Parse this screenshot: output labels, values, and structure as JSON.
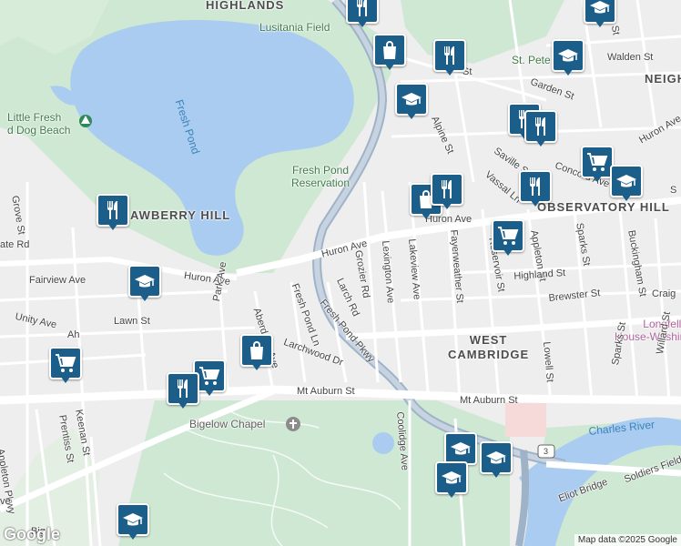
{
  "map": {
    "neighborhoods": {
      "highlands": "HIGHLANDS",
      "strawberry_hill": "STRAWBERRY HILL",
      "observatory_hill": "OBSERVATORY HILL",
      "west_cambridge": "WEST\nCAMBRIDGE",
      "neigh": "NEIGH"
    },
    "parks": {
      "lusitania_field": "Lusitania Field",
      "fresh_pond_reservation": "Fresh Pond\nReservation",
      "little_fresh_dog_beach": "Little Fresh\nd Dog Beach",
      "st_peters_field": "St. Pete        ld"
    },
    "water": {
      "fresh_pond": "Fresh Pond",
      "charles_river": "Charles River"
    },
    "places": {
      "bigelow_chapel": "Bigelow Chapel",
      "longfellow": "Longfellow\nHouse-Washington's..."
    },
    "streets": {
      "huron_ave_left": "Huron Ave",
      "huron_ave_mid": "Huron Ave",
      "huron_ave_right": "Huron Ave",
      "huron_ave_far": "Huron Ave",
      "mt_auburn_left": "Mt Auburn St",
      "mt_auburn_right": "Mt Auburn St",
      "fresh_pond_pkwy": "Fresh Pond Pkwy",
      "grozier_rd": "Grozier Rd",
      "larch_rd": "Larch Rd",
      "fresh_pond_ln": "Fresh Pond Ln",
      "larchwood_dr": "Larchwood Dr",
      "aberdeen_ave": "Aberdeen Ave",
      "lexington_ave": "Lexington Ave",
      "lakeview_ave": "Lakeview Ave",
      "fayerweather_st": "Fayerweather St",
      "reservoir_st": "Reservoir St",
      "appleton_st": "Appleton St",
      "sparks_st_top": "Sparks St",
      "sparks_st_bottom": "Sparks St",
      "buckingham_st": "Buckingham St",
      "highland_st": "Highland St",
      "brewster_st": "Brewster St",
      "lowell_st": "Lowell St",
      "willard_st": "Willard St",
      "craig": "Craig",
      "concord_ave": "Concord Ave",
      "garden_st": "Garden St",
      "walden_st": "Walden St",
      "alpine_st": "Alpine St",
      "saville_st": "Saville St",
      "vassal_ln": "Vassal Ln",
      "coolidge_ave": "Coolidge Ave",
      "grove_st": "Grove St",
      "fairview_ave": "Fairview Ave",
      "unity_ave": "Unity Ave",
      "lawn_st": "Lawn St",
      "park_ave": "Park Ave",
      "keenan_st": "Keenan St",
      "prentiss_st": "Prentiss St",
      "appleton_pkwy": "Appleton Pkwy",
      "eliot_bridge": "Eliot Bridge",
      "soldiers_field_rd": "Soldiers Field Rd",
      "route_badge": "3",
      "partial_ate_rd": "ate Rd",
      "partial_enan_st": "enan St",
      "partial_st": "St",
      "partial_s": "S",
      "partial_ve": "ve",
      "partial_ah": "Ah",
      "partial_big": "Big"
    },
    "pins": [
      {
        "type": "utensils-icon"
      },
      {
        "type": "shopping-bag-icon"
      },
      {
        "type": "utensils-icon"
      },
      {
        "type": "graduation-cap-icon"
      },
      {
        "type": "graduation-cap-icon"
      },
      {
        "type": "graduation-cap-icon"
      },
      {
        "type": "utensils-icon"
      },
      {
        "type": "utensils-icon"
      },
      {
        "type": "shopping-cart-icon"
      },
      {
        "type": "graduation-cap-icon"
      },
      {
        "type": "shopping-bag-icon"
      },
      {
        "type": "utensils-icon"
      },
      {
        "type": "utensils-icon"
      },
      {
        "type": "shopping-cart-icon"
      },
      {
        "type": "utensils-icon"
      },
      {
        "type": "graduation-cap-icon"
      },
      {
        "type": "shopping-cart-icon"
      },
      {
        "type": "shopping-bag-icon"
      },
      {
        "type": "shopping-cart-icon"
      },
      {
        "type": "utensils-icon"
      },
      {
        "type": "graduation-cap-icon"
      },
      {
        "type": "graduation-cap-icon"
      },
      {
        "type": "graduation-cap-icon"
      },
      {
        "type": "graduation-cap-icon"
      }
    ],
    "logo": "Google",
    "attribution": "Map data ©2025 Google"
  }
}
